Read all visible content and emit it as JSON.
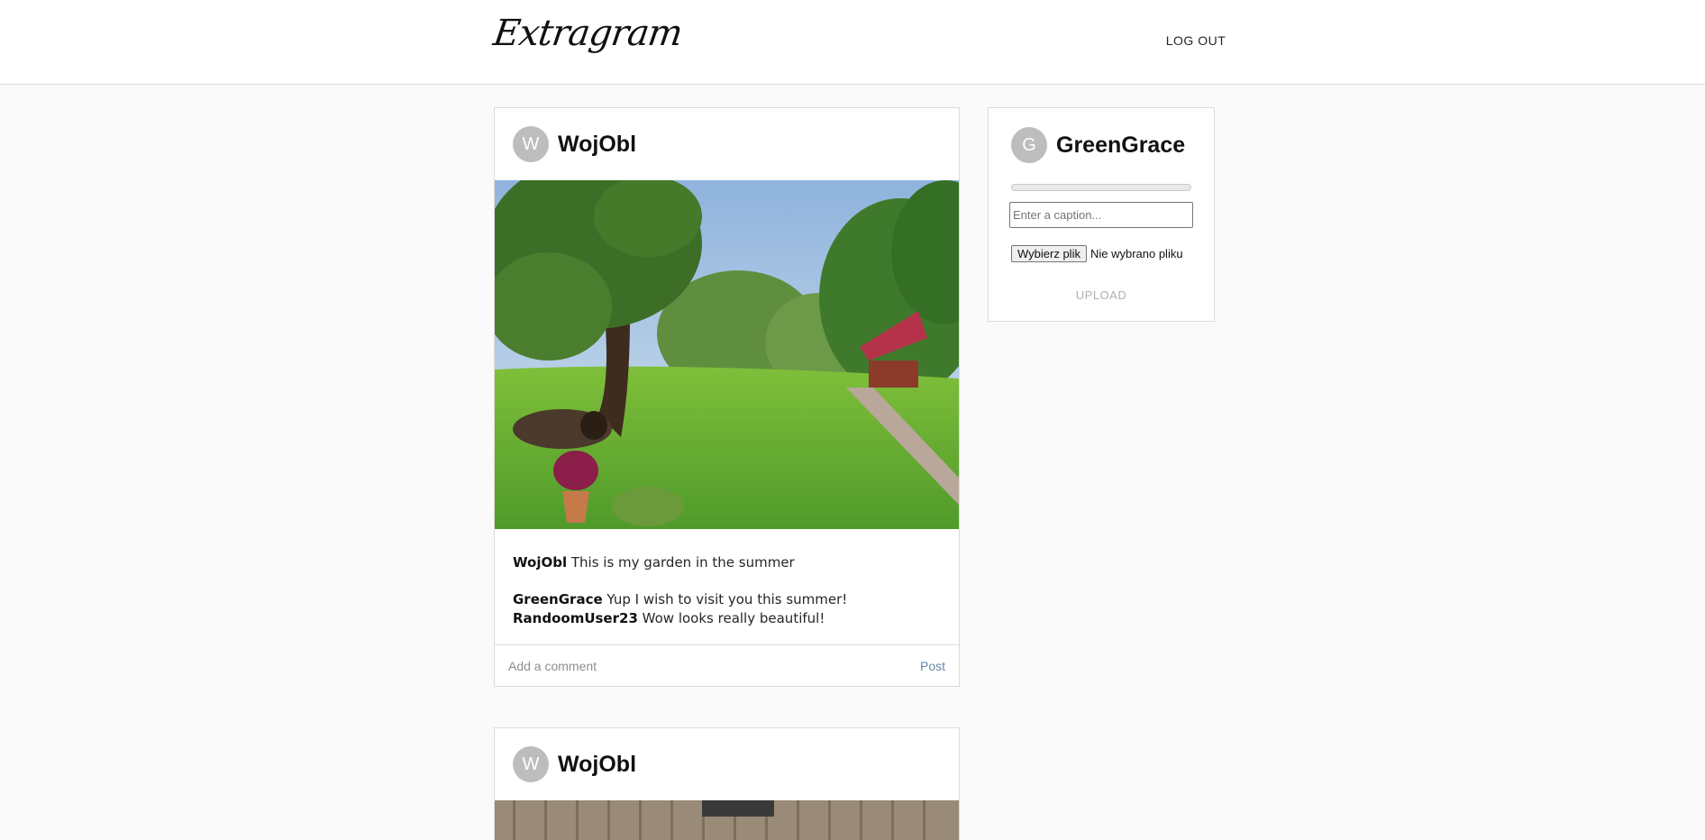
{
  "header": {
    "logo": "Extragram",
    "logout_label": "LOG OUT"
  },
  "posts": [
    {
      "avatar_letter": "W",
      "username": "WojObl",
      "caption_user": "WojObl",
      "caption_text": "This is my garden in the summer",
      "comments": [
        {
          "user": "GreenGrace",
          "text": "Yup I wish to visit you this summer!"
        },
        {
          "user": "RandoomUser23",
          "text": "Wow looks really beautiful!"
        }
      ],
      "comment_placeholder": "Add a comment",
      "post_label": "Post"
    },
    {
      "avatar_letter": "W",
      "username": "WojObl"
    }
  ],
  "upload": {
    "avatar_letter": "G",
    "username": "GreenGrace",
    "progress": 0,
    "caption_placeholder": "Enter a caption...",
    "file_button_label": "Wybierz plik",
    "file_status": "Nie wybrano pliku",
    "upload_label": "UPLOAD"
  }
}
